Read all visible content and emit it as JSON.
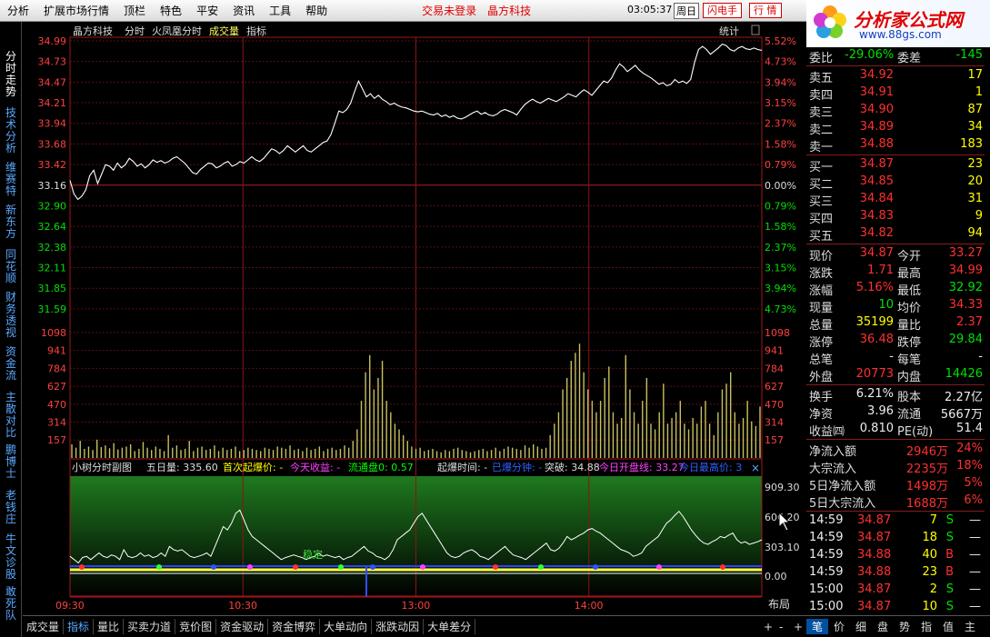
{
  "menu": {
    "items": [
      "分析",
      "扩展市场行情",
      "顶栏",
      "特色",
      "平安",
      "资讯",
      "工具",
      "帮助"
    ],
    "trade_status": "交易未登录",
    "stock_name": "晶方科技",
    "clock": "03:05:37",
    "day_label": "周日",
    "flash_btn": "闪电手",
    "quote_btn": "行 情"
  },
  "logo": {
    "title": "分析家公式网",
    "url": "www.88gs.com"
  },
  "left_tabs": [
    "分时走势",
    "技术分析",
    "维赛特",
    "新东方",
    "同花顺",
    "财务透视",
    "资金流",
    "主散对比",
    "鹏博士",
    "老钱庄",
    "牛文诊股",
    "敢死队"
  ],
  "chart_header": {
    "stock": "晶方科技",
    "items": [
      "分时",
      "火凤凰分时",
      "成交量",
      "指标"
    ],
    "stat_label": "统计"
  },
  "price_axis": {
    "left": [
      "34.99",
      "34.73",
      "34.47",
      "34.21",
      "33.94",
      "33.68",
      "33.42",
      "33.16",
      "32.90",
      "32.64",
      "32.38",
      "32.11",
      "31.85",
      "31.59"
    ],
    "right": [
      "5.52%",
      "4.73%",
      "3.94%",
      "3.15%",
      "2.37%",
      "1.58%",
      "0.79%",
      "0.00%",
      "0.79%",
      "1.58%",
      "2.37%",
      "3.15%",
      "3.94%",
      "4.73%"
    ]
  },
  "volume_axis": [
    "1098",
    "941",
    "784",
    "627",
    "470",
    "314",
    "157"
  ],
  "indicator": {
    "header": [
      {
        "t": "小树分时副图",
        "c": "#dddddd"
      },
      {
        "t": "五日量: 335.60",
        "c": "#dddddd"
      },
      {
        "t": "首次起爆价: -",
        "c": "#ffff00"
      },
      {
        "t": "今天收益: -",
        "c": "#ff40ff"
      },
      {
        "t": "流通盘0: 0.57",
        "c": "#00ff00"
      },
      {
        "t": "起爆时间: -",
        "c": "#dddddd"
      },
      {
        "t": "已爆分钟: -",
        "c": "#3060ff"
      },
      {
        "t": "突破: 34.88",
        "c": "#dddddd"
      },
      {
        "t": "今日开盘线: 33.27",
        "c": "#ff40ff"
      },
      {
        "t": "今日最高价: 3",
        "c": "#3060ff"
      }
    ],
    "axis": [
      "909.30",
      "606.20",
      "303.10",
      "0.00"
    ],
    "label": "稳定"
  },
  "time_axis": [
    "09:30",
    "10:30",
    "13:00",
    "14:00"
  ],
  "layout_btn": "布局",
  "bottom_tabs": [
    "成交量",
    "指标",
    "量比",
    "买卖力道",
    "竞价图",
    "资金驱动",
    "资金博弈",
    "大单动向",
    "涨跌动因",
    "大单差分"
  ],
  "bottom_nav": [
    "+",
    "-",
    "+"
  ],
  "right_tabs": [
    "笔",
    "价",
    "细",
    "盘",
    "势",
    "指",
    "值",
    "主"
  ],
  "quote": {
    "weibi": {
      "label": "委比",
      "value": "-29.06%",
      "label2": "委差",
      "value2": "-145"
    },
    "sells": [
      {
        "label": "卖五",
        "price": "34.92",
        "vol": "17"
      },
      {
        "label": "卖四",
        "price": "34.91",
        "vol": "1"
      },
      {
        "label": "卖三",
        "price": "34.90",
        "vol": "87"
      },
      {
        "label": "卖二",
        "price": "34.89",
        "vol": "34"
      },
      {
        "label": "卖一",
        "price": "34.88",
        "vol": "183"
      }
    ],
    "buys": [
      {
        "label": "买一",
        "price": "34.87",
        "vol": "23"
      },
      {
        "label": "买二",
        "price": "34.85",
        "vol": "20"
      },
      {
        "label": "买三",
        "price": "34.84",
        "vol": "31"
      },
      {
        "label": "买四",
        "price": "34.83",
        "vol": "9"
      },
      {
        "label": "买五",
        "price": "34.82",
        "vol": "94"
      }
    ],
    "stats": [
      {
        "l1": "现价",
        "v1": "34.87",
        "c1": "red",
        "l2": "今开",
        "v2": "33.27",
        "c2": "red"
      },
      {
        "l1": "涨跌",
        "v1": "1.71",
        "c1": "red",
        "l2": "最高",
        "v2": "34.99",
        "c2": "red"
      },
      {
        "l1": "涨幅",
        "v1": "5.16%",
        "c1": "red",
        "l2": "最低",
        "v2": "32.92",
        "c2": "grn"
      },
      {
        "l1": "现量",
        "v1": "10",
        "c1": "grn",
        "l2": "均价",
        "v2": "34.33",
        "c2": "red"
      },
      {
        "l1": "总量",
        "v1": "35199",
        "c1": "yel",
        "l2": "量比",
        "v2": "2.37",
        "c2": "red"
      },
      {
        "l1": "涨停",
        "v1": "36.48",
        "c1": "red",
        "l2": "跌停",
        "v2": "29.84",
        "c2": "grn"
      },
      {
        "l1": "总笔",
        "v1": "-",
        "c1": "wht",
        "l2": "每笔",
        "v2": "-",
        "c2": "wht"
      },
      {
        "l1": "外盘",
        "v1": "20773",
        "c1": "red",
        "l2": "内盘",
        "v2": "14426",
        "c2": "grn"
      }
    ],
    "stats2": [
      {
        "l1": "换手",
        "v1": "6.21%",
        "c1": "wht",
        "l2": "股本",
        "v2": "2.27亿",
        "c2": "wht"
      },
      {
        "l1": "净资",
        "v1": "3.96",
        "c1": "wht",
        "l2": "流通",
        "v2": "5667万",
        "c2": "wht"
      },
      {
        "l1": "收益㈣",
        "v1": "0.810",
        "c1": "wht",
        "l2": "PE(动)",
        "v2": "51.4",
        "c2": "wht"
      }
    ],
    "flows": [
      {
        "label": "净流入额",
        "v": "2946万",
        "p": "24%"
      },
      {
        "label": "大宗流入",
        "v": "2235万",
        "p": "18%"
      },
      {
        "label": "5日净流入额",
        "v": "1498万",
        "p": "5%"
      },
      {
        "label": "5日大宗流入",
        "v": "1688万",
        "p": "6%"
      }
    ],
    "trades": [
      {
        "t": "14:59",
        "p": "34.87",
        "v": "7",
        "s": "S"
      },
      {
        "t": "14:59",
        "p": "34.87",
        "v": "18",
        "s": "S"
      },
      {
        "t": "14:59",
        "p": "34.88",
        "v": "40",
        "s": "B"
      },
      {
        "t": "14:59",
        "p": "34.88",
        "v": "23",
        "s": "B"
      },
      {
        "t": "15:00",
        "p": "34.87",
        "v": "2",
        "s": "S"
      },
      {
        "t": "15:00",
        "p": "34.87",
        "v": "10",
        "s": "S"
      }
    ],
    "trade_dash": "—"
  },
  "series": {
    "price": [
      33.22,
      33.05,
      32.98,
      33.02,
      33.1,
      33.28,
      33.35,
      33.18,
      33.3,
      33.42,
      33.4,
      33.35,
      33.44,
      33.38,
      33.42,
      33.5,
      33.46,
      33.4,
      33.43,
      33.38,
      33.42,
      33.48,
      33.45,
      33.47,
      33.44,
      33.46,
      33.5,
      33.52,
      33.48,
      33.44,
      33.38,
      33.32,
      33.3,
      33.36,
      33.4,
      33.44,
      33.43,
      33.38,
      33.4,
      33.44,
      33.46,
      33.4,
      33.42,
      33.46,
      33.44,
      33.48,
      33.52,
      33.48,
      33.46,
      33.5,
      33.56,
      33.62,
      33.6,
      33.56,
      33.6,
      33.66,
      33.62,
      33.58,
      33.62,
      33.66,
      33.6,
      33.58,
      33.62,
      33.66,
      33.7,
      33.72,
      33.8,
      33.95,
      34.1,
      34.08,
      34.12,
      34.2,
      34.35,
      34.48,
      34.38,
      34.28,
      34.32,
      34.26,
      34.3,
      34.25,
      34.22,
      34.18,
      34.2,
      34.17,
      34.15,
      34.14,
      34.12,
      34.1,
      34.09,
      34.1,
      34.08,
      34.06,
      34.05,
      34.07,
      34.03,
      34.05,
      34.02,
      34.04,
      34.01,
      34.0,
      34.02,
      34.05,
      34.08,
      34.1,
      34.06,
      34.08,
      34.05,
      34.04,
      34.06,
      34.1,
      34.12,
      34.1,
      34.08,
      34.05,
      34.12,
      34.18,
      34.22,
      34.25,
      34.22,
      34.2,
      34.23,
      34.26,
      34.24,
      34.22,
      34.25,
      34.28,
      34.32,
      34.3,
      34.28,
      34.33,
      34.37,
      34.34,
      34.3,
      34.36,
      34.42,
      34.48,
      34.46,
      34.52,
      34.62,
      34.7,
      34.66,
      34.6,
      34.64,
      34.68,
      34.62,
      34.58,
      34.55,
      34.52,
      34.48,
      34.44,
      34.46,
      34.42,
      34.44,
      34.5,
      34.46,
      34.48,
      34.45,
      34.5,
      34.72,
      34.88,
      34.92,
      34.88,
      34.82,
      34.86,
      34.9,
      34.95,
      34.93,
      34.88,
      34.86,
      34.9,
      34.92,
      34.89,
      34.88,
      34.9,
      34.88,
      34.87
    ],
    "volume": [
      120,
      90,
      150,
      80,
      100,
      70,
      160,
      95,
      110,
      85,
      130,
      75,
      90,
      100,
      120,
      60,
      80,
      140,
      90,
      70,
      100,
      80,
      60,
      200,
      90,
      110,
      70,
      80,
      150,
      60,
      90,
      100,
      70,
      80,
      110,
      60,
      90,
      70,
      80,
      100,
      60,
      70,
      90,
      80,
      70,
      60,
      90,
      80,
      70,
      100,
      90,
      80,
      110,
      70,
      80,
      60,
      90,
      70,
      80,
      100,
      60,
      80,
      90,
      70,
      80,
      110,
      90,
      150,
      250,
      500,
      750,
      900,
      600,
      700,
      850,
      500,
      400,
      300,
      250,
      200,
      150,
      100,
      80,
      90,
      60,
      70,
      80,
      60,
      50,
      70,
      60,
      80,
      90,
      70,
      60,
      50,
      60,
      70,
      80,
      60,
      70,
      90,
      60,
      80,
      100,
      90,
      80,
      70,
      110,
      90,
      120,
      100,
      80,
      90,
      200,
      300,
      400,
      600,
      700,
      850,
      920,
      1000,
      750,
      600,
      500,
      400,
      500,
      700,
      800,
      400,
      300,
      350,
      900,
      600,
      400,
      300,
      500,
      700,
      300,
      250,
      400,
      650,
      300,
      350,
      400,
      500,
      300,
      250,
      350,
      300,
      450,
      500,
      300,
      200,
      400,
      600,
      650,
      750,
      400,
      300,
      350,
      500,
      320,
      280,
      450
    ],
    "indicator": [
      30,
      25,
      20,
      28,
      30,
      25,
      30,
      35,
      30,
      28,
      32,
      30,
      25,
      40,
      30,
      28,
      30,
      35,
      30,
      32,
      28,
      30,
      35,
      30,
      45,
      40,
      38,
      40,
      35,
      30,
      28,
      30,
      32,
      35,
      30,
      45,
      60,
      75,
      70,
      80,
      95,
      100,
      85,
      70,
      60,
      55,
      50,
      45,
      40,
      35,
      30,
      25,
      28,
      30,
      32,
      30,
      28,
      25,
      28,
      30,
      35,
      30,
      32,
      30,
      28,
      30,
      25,
      28,
      30,
      35,
      40,
      45,
      38,
      35,
      30,
      28,
      25,
      30,
      40,
      55,
      60,
      65,
      70,
      80,
      90,
      95,
      85,
      75,
      65,
      55,
      45,
      35,
      30,
      28,
      30,
      35,
      38,
      40,
      36,
      30,
      28,
      25,
      30,
      35,
      40,
      45,
      38,
      32,
      30,
      28,
      25,
      30,
      35,
      40,
      45,
      50,
      40,
      38,
      42,
      50,
      60,
      55,
      58,
      62,
      65,
      70,
      72,
      68,
      65,
      60,
      55,
      50,
      45,
      40,
      38,
      35,
      30,
      32,
      35,
      45,
      50,
      55,
      60,
      70,
      80,
      85,
      92,
      98,
      90,
      80,
      70,
      62,
      55,
      50,
      48,
      52,
      55,
      60,
      58,
      62,
      65,
      55,
      50,
      52,
      48,
      50,
      52,
      55
    ]
  }
}
